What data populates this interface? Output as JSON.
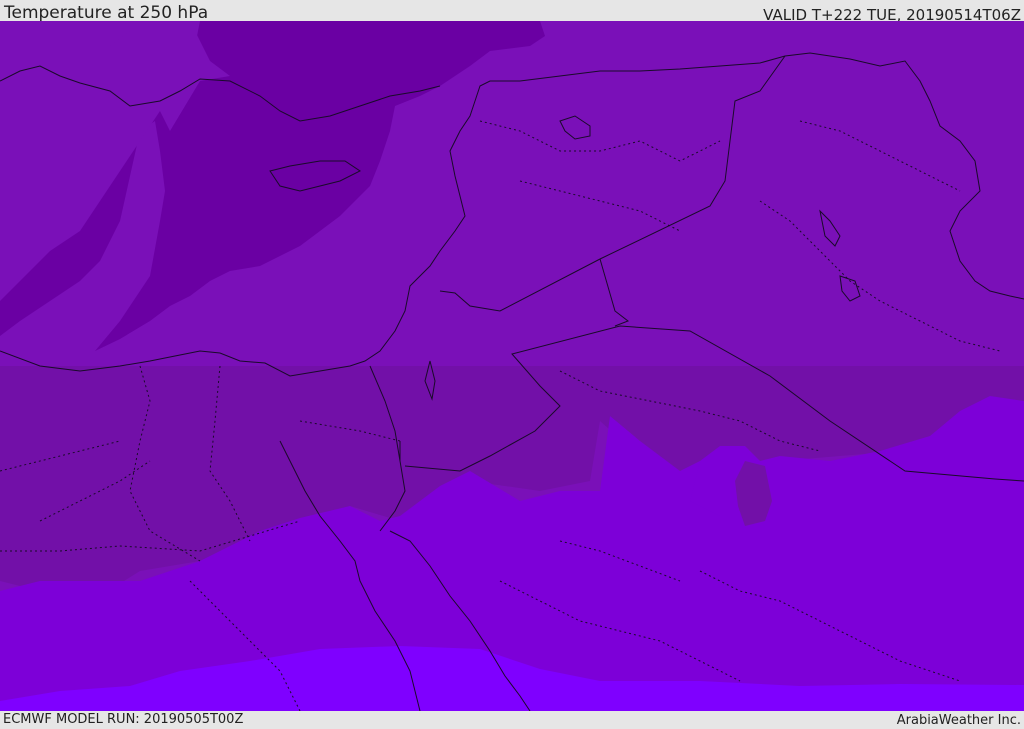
{
  "header": {
    "title": "Temperature at 250 hPa",
    "valid": "VALID T+222 TUE, 20190514T06Z"
  },
  "footer": {
    "model_run": "ECMWF MODEL RUN: 20190505T00Z",
    "credit": "ArabiaWeather Inc."
  },
  "map": {
    "variable": "temperature",
    "level": "250 hPa",
    "region": "Eastern Mediterranean and Middle East",
    "colors": {
      "band_coldest": "#6a00a3",
      "band_cold": "#7a10b8",
      "band_mid": "#7210a8",
      "band_warm": "#7d00d8",
      "band_warmest": "#7f00ff",
      "coastline": "#1a0a2a",
      "border": "#1a0a2a"
    }
  }
}
